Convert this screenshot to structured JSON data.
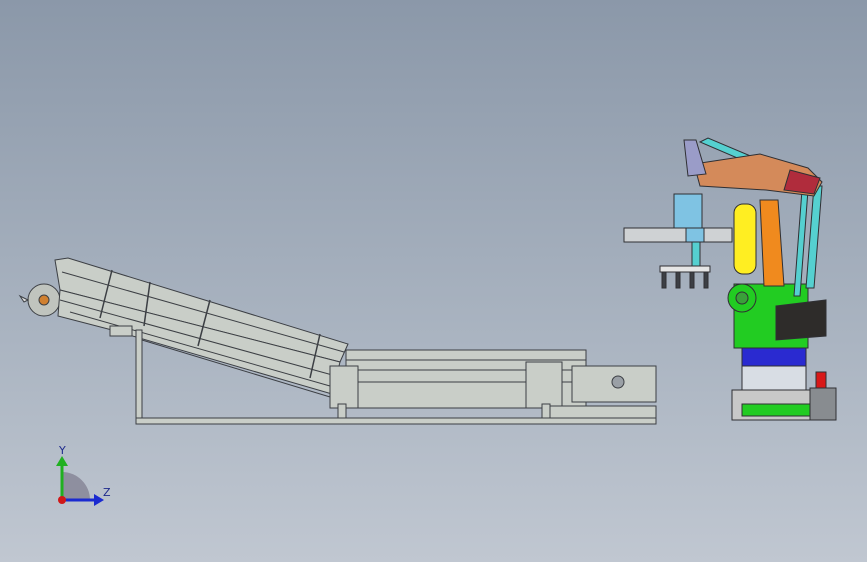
{
  "viewport": {
    "background_top": "#8b98a9",
    "background_bottom": "#c0c7d1"
  },
  "triad": {
    "y_label": "Y",
    "z_label": "Z",
    "colors": {
      "y": "#20b020",
      "z": "#1a2ad0",
      "x": "#d01818",
      "origin": "#8a8a9a"
    }
  },
  "model": {
    "conveyor": {
      "color": "#c9cec8",
      "edge_color": "#3c3f44"
    },
    "robot": {
      "colors": {
        "upper_arm": "#d48a5a",
        "arm_tip": "#b02c3c",
        "links": "#55d0d0",
        "cylinder": "#ffee22",
        "orange_link": "#f08a1e",
        "base": "#22cc22",
        "dark_cover": "#2e2c2a",
        "turntable": "#2a2ad0",
        "foundation": "#c8c8c8",
        "red_block": "#d81818",
        "gripper_blue": "#7fc3e3",
        "gripper_grey": "#cfd2d4"
      }
    }
  }
}
